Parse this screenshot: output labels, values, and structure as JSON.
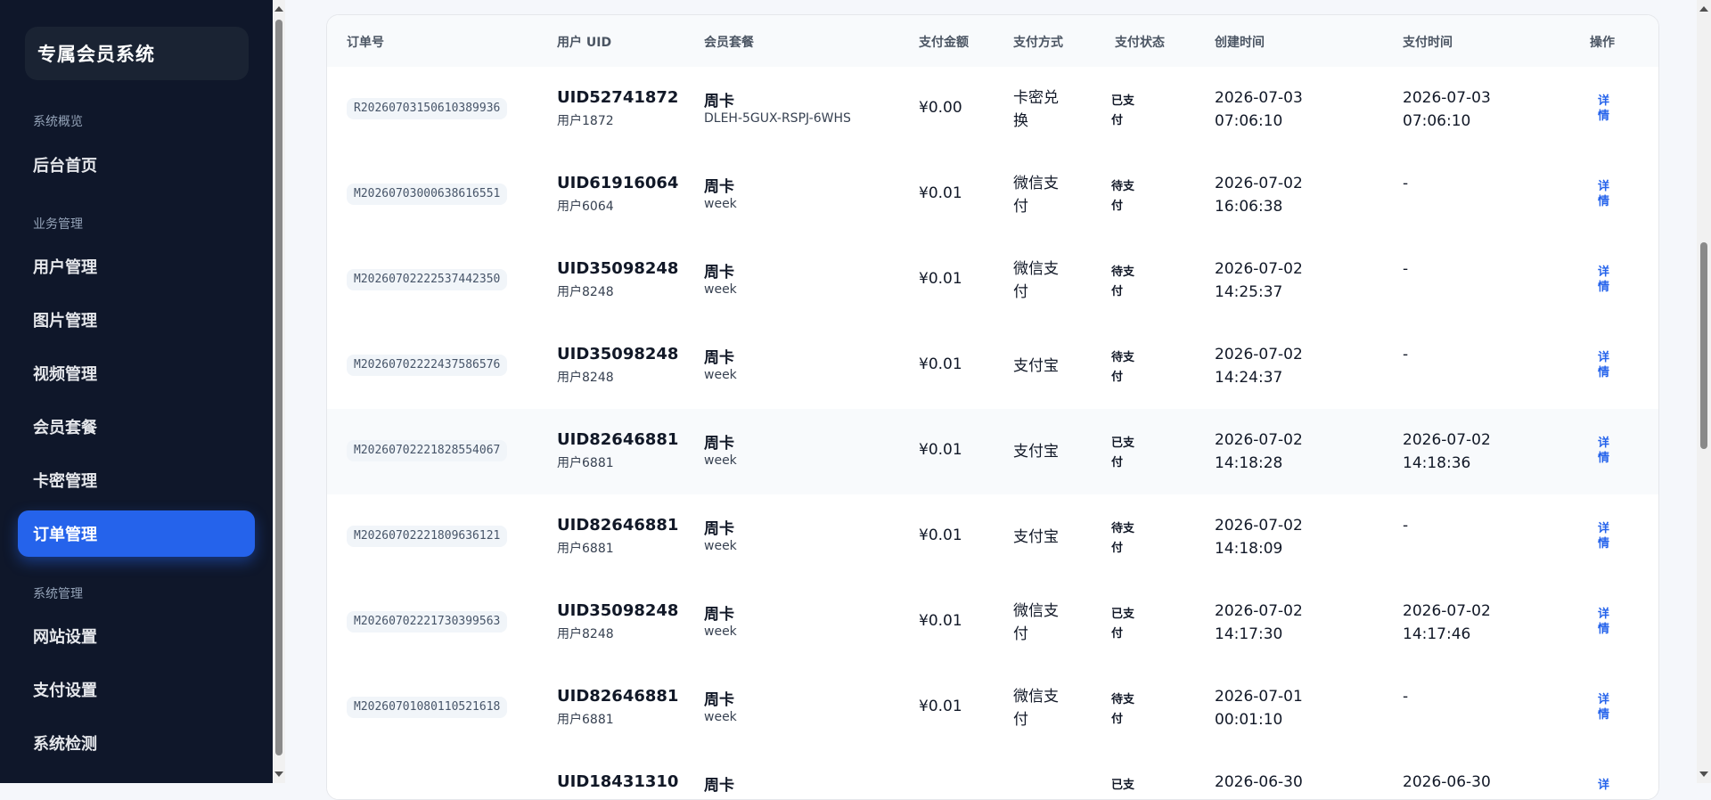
{
  "sidebar": {
    "brand": "专属会员系统",
    "sections": {
      "overview": "系统概览",
      "business": "业务管理",
      "system": "系统管理"
    },
    "items": [
      {
        "label": "后台首页"
      },
      {
        "label": "用户管理"
      },
      {
        "label": "图片管理"
      },
      {
        "label": "视频管理"
      },
      {
        "label": "会员套餐"
      },
      {
        "label": "卡密管理"
      },
      {
        "label": "订单管理",
        "active": true
      },
      {
        "label": "网站设置"
      },
      {
        "label": "支付设置"
      },
      {
        "label": "系统检测"
      }
    ]
  },
  "table": {
    "headers": {
      "order_no": "订单号",
      "user_uid": "用户 UID",
      "plan": "会员套餐",
      "amount": "支付金额",
      "method": "支付方式",
      "status": "支付状态",
      "created": "创建时间",
      "paid": "支付时间",
      "action": "操作"
    },
    "rows": [
      {
        "order_no": "R20260703150610389936",
        "uid": "UID52741872",
        "user": "用户1872",
        "plan": "周卡",
        "plan_sub": "DLEH-5GUX-RSPJ-6WHS",
        "amount": "¥0.00",
        "method": "卡密兑换",
        "status": "已支付",
        "created": "2026-07-03 07:06:10",
        "paid": "2026-07-03 07:06:10",
        "action": "详情"
      },
      {
        "order_no": "M20260703000638616551",
        "uid": "UID61916064",
        "user": "用户6064",
        "plan": "周卡",
        "plan_sub": "week",
        "amount": "¥0.01",
        "method": "微信支付",
        "status": "待支付",
        "created": "2026-07-02 16:06:38",
        "paid": "-",
        "action": "详情"
      },
      {
        "order_no": "M20260702222537442350",
        "uid": "UID35098248",
        "user": "用户8248",
        "plan": "周卡",
        "plan_sub": "week",
        "amount": "¥0.01",
        "method": "微信支付",
        "status": "待支付",
        "created": "2026-07-02 14:25:37",
        "paid": "-",
        "action": "详情"
      },
      {
        "order_no": "M20260702222437586576",
        "uid": "UID35098248",
        "user": "用户8248",
        "plan": "周卡",
        "plan_sub": "week",
        "amount": "¥0.01",
        "method": "支付宝",
        "status": "待支付",
        "created": "2026-07-02 14:24:37",
        "paid": "-",
        "action": "详情"
      },
      {
        "order_no": "M20260702221828554067",
        "uid": "UID82646881",
        "user": "用户6881",
        "plan": "周卡",
        "plan_sub": "week",
        "amount": "¥0.01",
        "method": "支付宝",
        "status": "已支付",
        "created": "2026-07-02 14:18:28",
        "paid": "2026-07-02 14:18:36",
        "action": "详情"
      },
      {
        "order_no": "M20260702221809636121",
        "uid": "UID82646881",
        "user": "用户6881",
        "plan": "周卡",
        "plan_sub": "week",
        "amount": "¥0.01",
        "method": "支付宝",
        "status": "待支付",
        "created": "2026-07-02 14:18:09",
        "paid": "-",
        "action": "详情"
      },
      {
        "order_no": "M20260702221730399563",
        "uid": "UID35098248",
        "user": "用户8248",
        "plan": "周卡",
        "plan_sub": "week",
        "amount": "¥0.01",
        "method": "微信支付",
        "status": "已支付",
        "created": "2026-07-02 14:17:30",
        "paid": "2026-07-02 14:17:46",
        "action": "详情"
      },
      {
        "order_no": "M20260701080110521618",
        "uid": "UID82646881",
        "user": "用户6881",
        "plan": "周卡",
        "plan_sub": "week",
        "amount": "¥0.01",
        "method": "微信支付",
        "status": "待支付",
        "created": "2026-07-01 00:01:10",
        "paid": "-",
        "action": "详情"
      },
      {
        "order_no": "",
        "uid": "UID18431310",
        "user": "",
        "plan": "周卡",
        "plan_sub": "",
        "amount": "",
        "method": "",
        "status": "已支",
        "created": "2026-06-30",
        "paid": "2026-06-30",
        "action": "详"
      }
    ]
  }
}
